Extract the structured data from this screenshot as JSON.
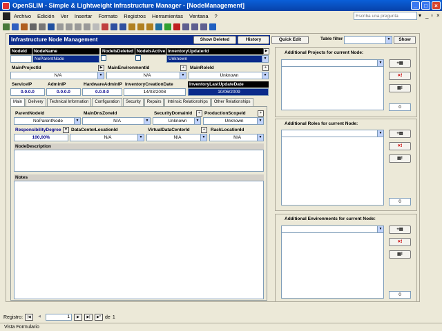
{
  "window": {
    "title": "OpenSLIM - Simple & Lightweight Infrastructure Manager - [NodeManagement]"
  },
  "menu": [
    "Archivo",
    "Edición",
    "Ver",
    "Insertar",
    "Formato",
    "Registros",
    "Herramientas",
    "Ventana",
    "?"
  ],
  "ask": {
    "placeholder": "Escriba una pregunta"
  },
  "form": {
    "title": "Infrastructure Node Management",
    "buttons": {
      "show_deleted": "Show Deleted",
      "history": "History",
      "quick_edit": "Quick Edit",
      "show": "Show"
    },
    "table_filter_label": "Table filter"
  },
  "fields": {
    "node_id": {
      "label": "NodeId",
      "value": ""
    },
    "node_name": {
      "label": "NodeName",
      "value": "NoParentNode"
    },
    "node_is_deleted": {
      "label": "NodeIsDeleted"
    },
    "node_is_active": {
      "label": "NodeIsActive"
    },
    "inventory_updater_id": {
      "label": "InventoryUpdaterId",
      "value": "Unknown"
    },
    "main_project_id": {
      "label": "MainProjectId",
      "value": "N/A"
    },
    "main_environment_id": {
      "label": "MainEnvironmentId",
      "value": "N/A"
    },
    "main_role_id": {
      "label": "MainRoleId",
      "value": "Unknown"
    },
    "service_ip": {
      "label": "ServiceIP",
      "value": "0.0.0.0"
    },
    "admin_ip": {
      "label": "AdminIP",
      "value": "0.0.0.0"
    },
    "hardware_admin_ip": {
      "label": "HardwareAdminIP",
      "value": "0.0.0.0"
    },
    "inventory_creation_date": {
      "label": "InventoryCreationDate",
      "value": "14/03/2008"
    },
    "inventory_last_update_date": {
      "label": "InventoryLastUpdateDate",
      "value": "10/06/2009"
    }
  },
  "tabs": [
    "Main",
    "Delivery",
    "Technical Information",
    "Configuration",
    "Security",
    "Repairs",
    "Intrinsic Relationships",
    "Other Relationships"
  ],
  "main_tab": {
    "parent_node_id": {
      "label": "ParentNodeId",
      "value": "NoParentNode"
    },
    "main_dns_zone_id": {
      "label": "MainDnsZoneId",
      "value": "N/A"
    },
    "security_domain_id": {
      "label": "SecurityDomainId",
      "value": "Unknown"
    },
    "production_scope_id": {
      "label": "ProductionScopeId",
      "value": "Unknown"
    },
    "responsibility_degree": {
      "label": "ResponsibilityDegree",
      "value": "100,00%"
    },
    "data_center_location_id": {
      "label": "DataCenterLocationId",
      "value": "N/A"
    },
    "virtual_data_center_id": {
      "label": "VirtualDataCenterId",
      "value": "N/A"
    },
    "rack_location_id": {
      "label": "RackLocationId",
      "value": "N/A"
    },
    "node_description_label": "NodeDescription",
    "notes_label": "Notes"
  },
  "right_panels": {
    "projects": {
      "title": "Additional Projects for current Node:",
      "count": "0"
    },
    "roles": {
      "title": "Additional Roles for current Node:",
      "count": "0"
    },
    "environments": {
      "title": "Additional Environments for current Node:",
      "count": "0"
    }
  },
  "navigation": {
    "label": "Registro:",
    "current": "1",
    "of_label": "de",
    "total": "1"
  },
  "status": {
    "text": "Vista Formulario"
  }
}
